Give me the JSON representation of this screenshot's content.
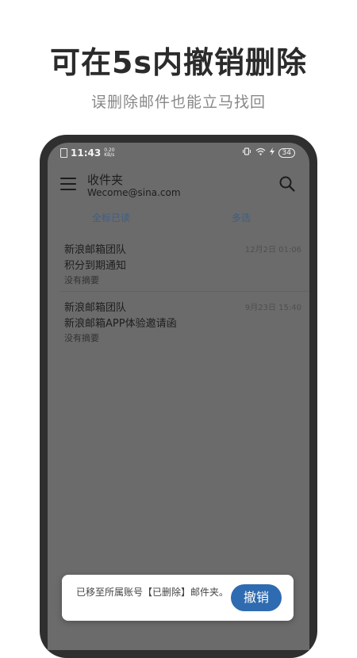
{
  "headline": "可在5s内撤销删除",
  "subheadline": "误删除邮件也能立马找回",
  "status_bar": {
    "time": "11:43",
    "speed_value": "0.20",
    "speed_unit": "KB/s",
    "battery": "34"
  },
  "header": {
    "title": "收件夹",
    "account": "Wecome@sina.com",
    "menu_icon": "hamburger-menu-icon",
    "search_icon": "search-icon"
  },
  "actions": {
    "mark_all_read": "全标已读",
    "multi_select": "多选"
  },
  "mails": [
    {
      "sender": "新浪邮箱团队",
      "subject": "积分到期通知",
      "summary": "没有摘要",
      "time": "12月2日 01:06"
    },
    {
      "sender": "新浪邮箱团队",
      "subject": "新浪邮箱APP体验邀请函",
      "summary": "没有摘要",
      "time": "9月23日 15:40"
    }
  ],
  "toast": {
    "message": "已移至所属账号【已删除】邮件夹。",
    "undo_label": "撤销"
  },
  "colors": {
    "undo_button": "#2f6bb0",
    "action_link": "#3f5e86",
    "dim_overlay": "#6b6b6b"
  }
}
